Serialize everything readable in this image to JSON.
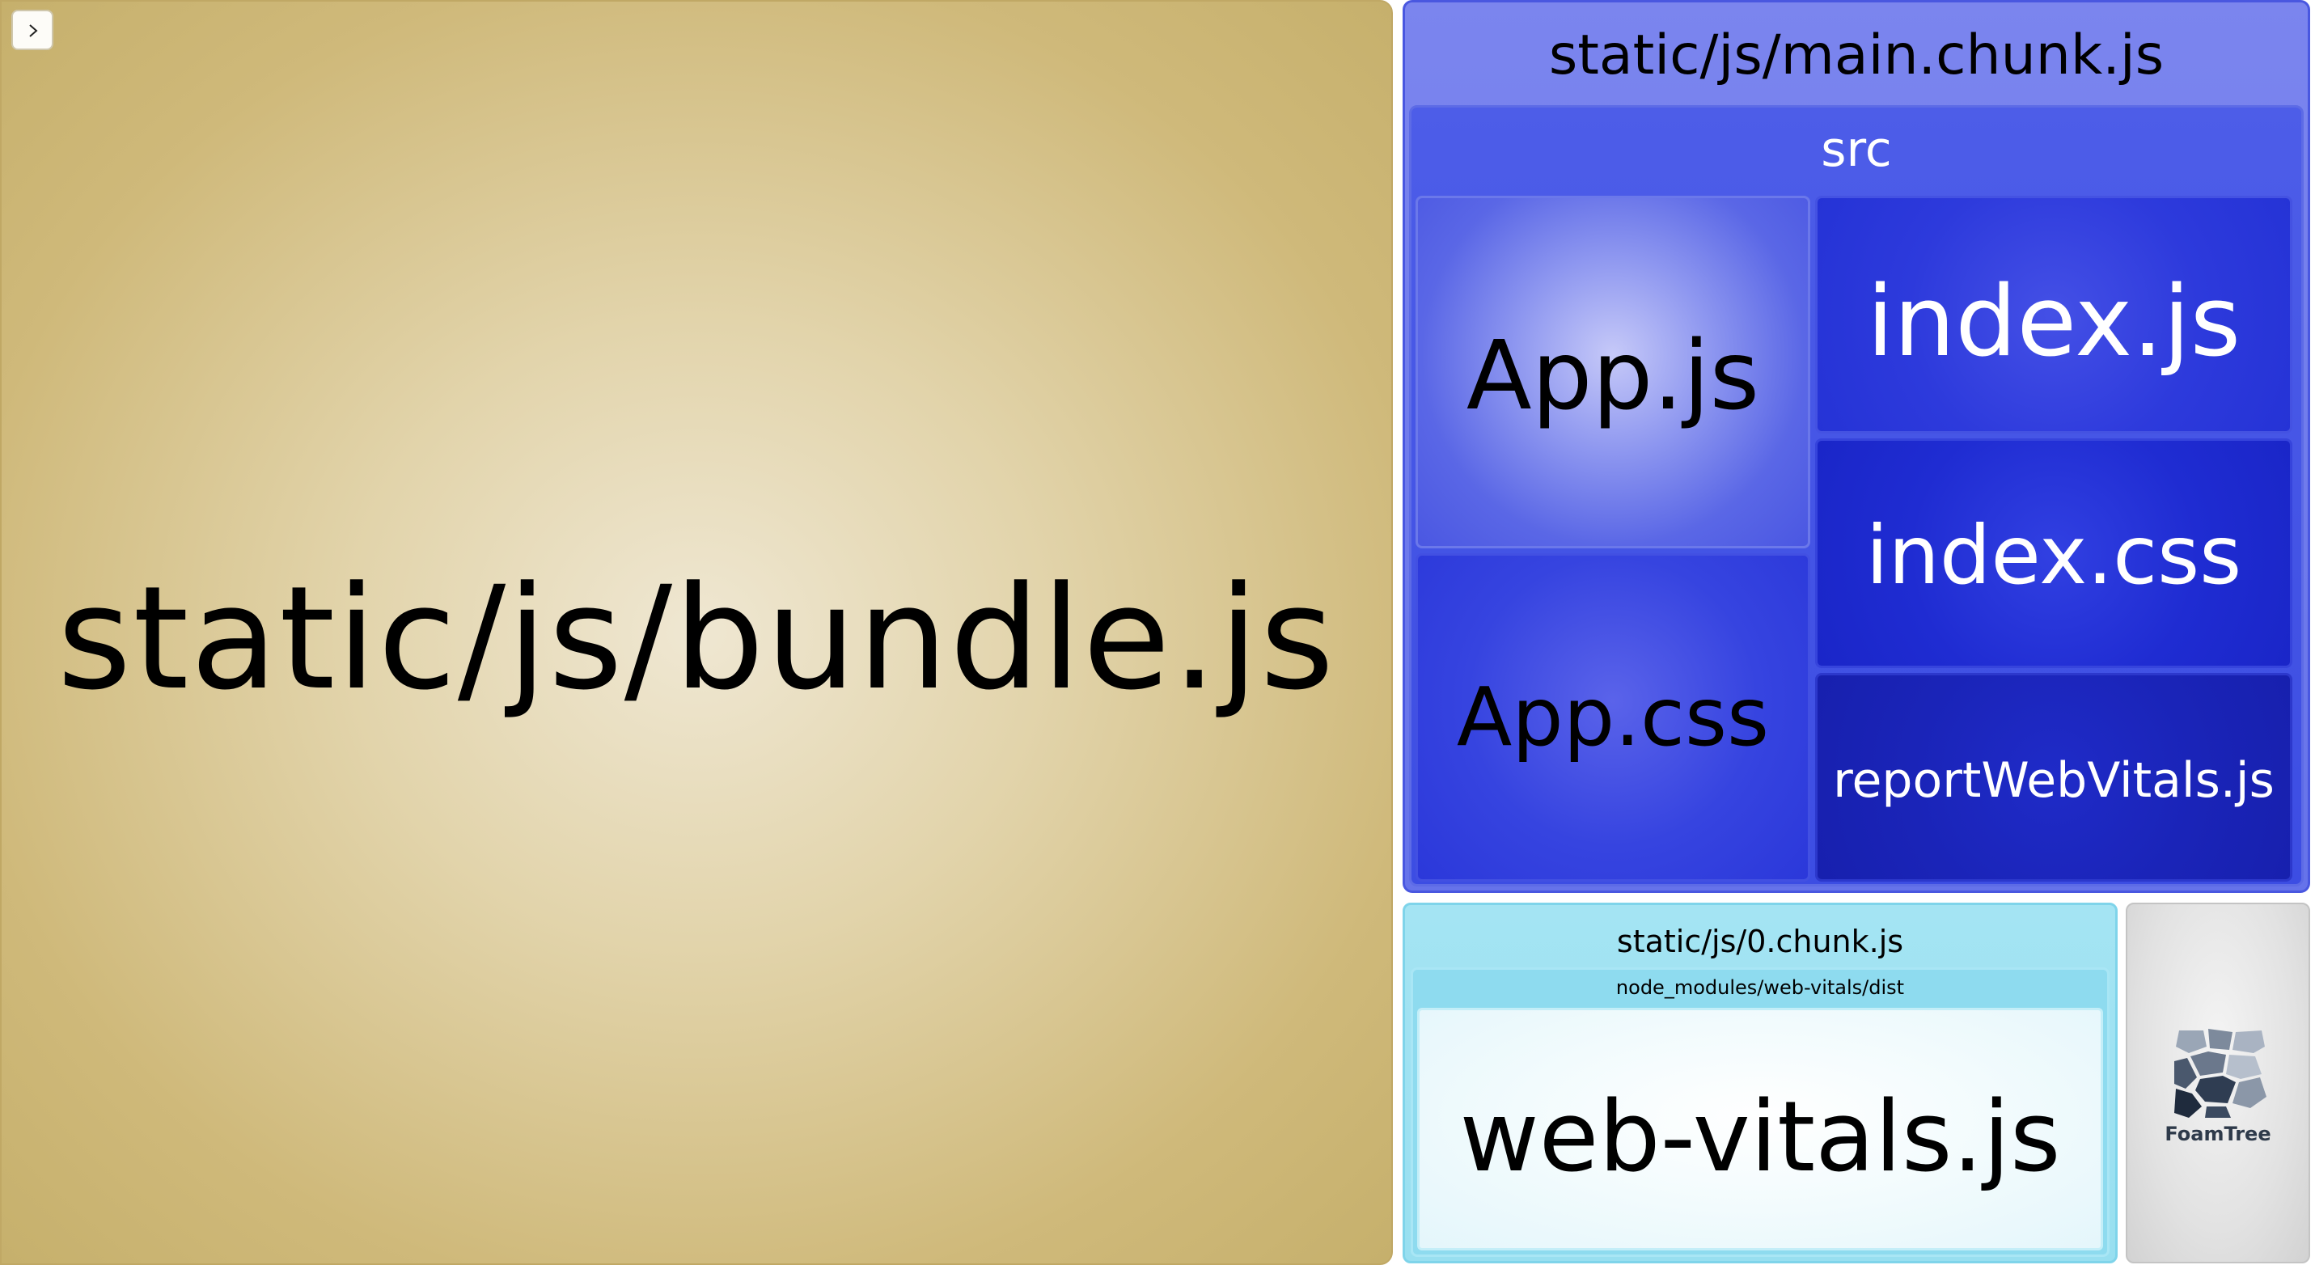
{
  "toolbar": {
    "toggle_icon": "chevron-right-icon"
  },
  "treemap": {
    "bundle": {
      "label": "static/js/bundle.js",
      "color": "#d9c891"
    },
    "main_chunk": {
      "label": "static/js/main.chunk.js",
      "color": "#6e79ec",
      "src": {
        "label": "src",
        "files": {
          "app_js": "App.js",
          "app_css": "App.css",
          "index_js": "index.js",
          "index_css": "index.css",
          "report_web_vitals": "reportWebVitals.js"
        }
      }
    },
    "chunk0": {
      "label": "static/js/0.chunk.js",
      "color": "#a4e4f3",
      "dist": {
        "label": "node_modules/web-vitals/dist",
        "file": "web-vitals.js"
      }
    }
  },
  "branding": {
    "label": "FoamTree",
    "icon": "foamtree-logo-icon"
  }
}
